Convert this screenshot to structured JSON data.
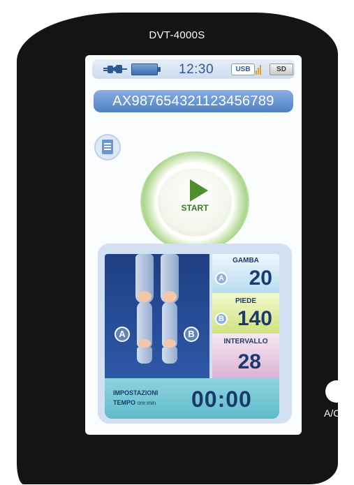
{
  "device": {
    "title": "DVT-4000S"
  },
  "status_bar": {
    "time": "12:30",
    "usb_label": "USB",
    "sd_label": "SD",
    "icons": [
      "plug-icon",
      "battery-icon",
      "usb-icon",
      "sd-card-icon"
    ]
  },
  "serial": "AX987654321123456789",
  "menu_icon": "document-icon",
  "start_button": {
    "label": "START",
    "icon": "play-icon"
  },
  "legs": {
    "left_badge": "A",
    "right_badge": "B"
  },
  "settings": {
    "gamba": {
      "label": "GAMBA",
      "badge": "A",
      "value": "20"
    },
    "piede": {
      "label": "PIEDE",
      "badge": "B",
      "value": "140"
    },
    "intervallo": {
      "label": "INTERVALLO",
      "value": "28"
    }
  },
  "timer": {
    "label_line1": "IMPOSTAZIONI",
    "label_line2": "TEMPO",
    "units": "ore:min",
    "value": "00:00"
  },
  "ac_button": {
    "label": "A/C"
  },
  "colors": {
    "device_body": "#141414",
    "screen_bg": "#fbfcfe",
    "serial_bar": "#5b8acb",
    "start_accent": "#4e8f2b",
    "gamba_bg": "#b7dcf0",
    "piede_bg": "#cfe27d",
    "intervallo_bg": "#dcb2d3",
    "timer_bg": "#6fc4d2"
  }
}
